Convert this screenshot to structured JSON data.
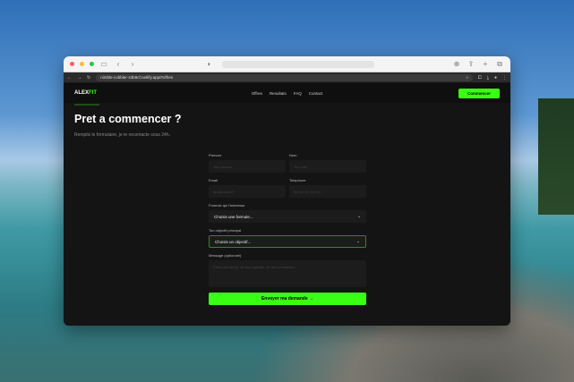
{
  "browser": {
    "url": "nimble-cobbler-43b9cf.netlify.app/#offres"
  },
  "site": {
    "logo": {
      "part1": "ALEX",
      "part2": "FIT"
    },
    "nav": [
      "Offres",
      "Resultats",
      "FAQ",
      "Contact"
    ],
    "cta": "Commencer",
    "title": "Pret a commencer ?",
    "subtitle": "Remplis le formulaire, je te recontacte sous 24h.",
    "form": {
      "prenom": {
        "label": "Prenom",
        "placeholder": "Ton prenom"
      },
      "nom": {
        "label": "Nom",
        "placeholder": "Ton nom"
      },
      "email": {
        "label": "Email",
        "placeholder": "ton@email.fr"
      },
      "telephone": {
        "label": "Telephone",
        "placeholder": "06 XX XX XX XX"
      },
      "formule": {
        "label": "Formule qui t'interesse",
        "value": "Choisis une formule..."
      },
      "objectif": {
        "label": "Ton objectif principal",
        "value": "Choisis un objectif..."
      },
      "message": {
        "label": "Message (optionnel)",
        "placeholder": "Parle-moi de toi, de tes objectifs, de tes contraintes..."
      },
      "submit": "Envoyer ma demande →"
    }
  }
}
